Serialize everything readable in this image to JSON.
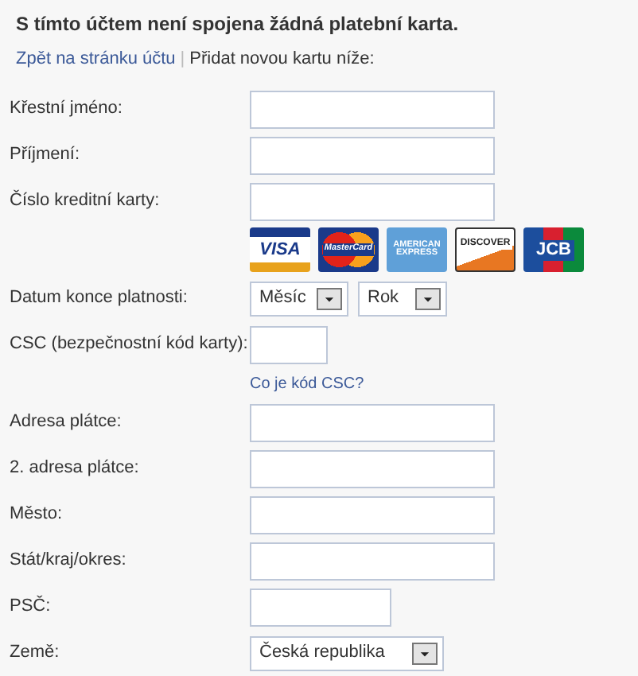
{
  "heading": "S tímto účtem není spojena žádná platební karta.",
  "nav": {
    "back_link": "Zpět na stránku účtu",
    "separator": "|",
    "add_text": "Přidat novou kartu níže:"
  },
  "rows": [
    {
      "kind": "text",
      "label": "Křestní jméno:"
    },
    {
      "kind": "text",
      "label": "Příjmení:"
    },
    {
      "kind": "text",
      "label": "Číslo kreditní karty:"
    },
    {
      "kind": "cards",
      "cards": [
        {
          "kind": "visa",
          "lines": [
            "VISA"
          ]
        },
        {
          "kind": "mastercard",
          "lines": [
            "MasterCard"
          ]
        },
        {
          "kind": "amex",
          "lines": [
            "AMERICAN",
            "EXPRESS"
          ]
        },
        {
          "kind": "discover",
          "lines": [
            "DISCOVER"
          ]
        },
        {
          "kind": "jcb",
          "lines": [
            "JCB"
          ]
        }
      ]
    },
    {
      "kind": "expiry",
      "label": "Datum konce platnosti:",
      "selects": [
        {
          "value": "Měsíc"
        },
        {
          "value": "Rok"
        }
      ]
    },
    {
      "kind": "csc",
      "label": "CSC (bezpečnostní kód karty):"
    },
    {
      "kind": "help-link",
      "text": "Co je kód CSC?"
    },
    {
      "kind": "text",
      "label": "Adresa plátce:"
    },
    {
      "kind": "text",
      "label": "2. adresa plátce:"
    },
    {
      "kind": "text",
      "label": "Město:"
    },
    {
      "kind": "text",
      "label": "Stát/kraj/okres:"
    },
    {
      "kind": "zip",
      "label": "PSČ:"
    },
    {
      "kind": "country",
      "label": "Země:",
      "value": "Česká republika"
    }
  ]
}
